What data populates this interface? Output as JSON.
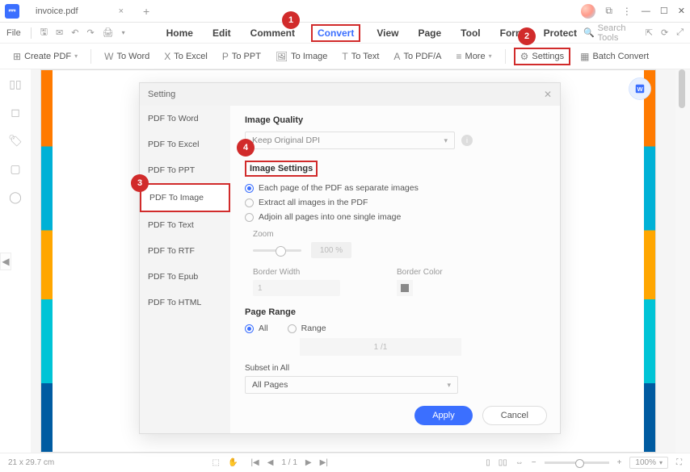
{
  "titlebar": {
    "filename": "invoice.pdf"
  },
  "menubar": {
    "file": "File",
    "tabs": [
      "Home",
      "Edit",
      "Comment",
      "Convert",
      "View",
      "Page",
      "Tool",
      "Form",
      "Protect"
    ],
    "active_tab": "Convert",
    "search_placeholder": "Search Tools"
  },
  "ribbon": {
    "create": "Create PDF",
    "to_word": "To Word",
    "to_excel": "To Excel",
    "to_ppt": "To PPT",
    "to_image": "To Image",
    "to_text": "To Text",
    "to_pdfa": "To PDF/A",
    "more": "More",
    "settings": "Settings",
    "batch": "Batch Convert"
  },
  "dialog": {
    "title": "Setting",
    "side_items": [
      "PDF To Word",
      "PDF To Excel",
      "PDF To PPT",
      "PDF To Image",
      "PDF To Text",
      "PDF To RTF",
      "PDF To Epub",
      "PDF To HTML"
    ],
    "section_quality": "Image Quality",
    "quality_value": "Keep Original DPI",
    "section_settings": "Image Settings",
    "radio1": "Each page of the PDF as separate images",
    "radio2": "Extract all images in the PDF",
    "radio3": "Adjoin all pages into one single image",
    "zoom_label": "Zoom",
    "zoom_value": "100 %",
    "border_width_label": "Border Width",
    "border_width_value": "1",
    "border_color_label": "Border Color",
    "section_range": "Page Range",
    "range_all": "All",
    "range_range": "Range",
    "range_value": "1 /1",
    "subset_label": "Subset in All",
    "subset_value": "All Pages",
    "apply": "Apply",
    "cancel": "Cancel"
  },
  "statusbar": {
    "dims": "21 x 29.7 cm",
    "page": "1 / 1",
    "zoom": "100%"
  },
  "markers": {
    "m1": "1",
    "m2": "2",
    "m3": "3",
    "m4": "4"
  }
}
